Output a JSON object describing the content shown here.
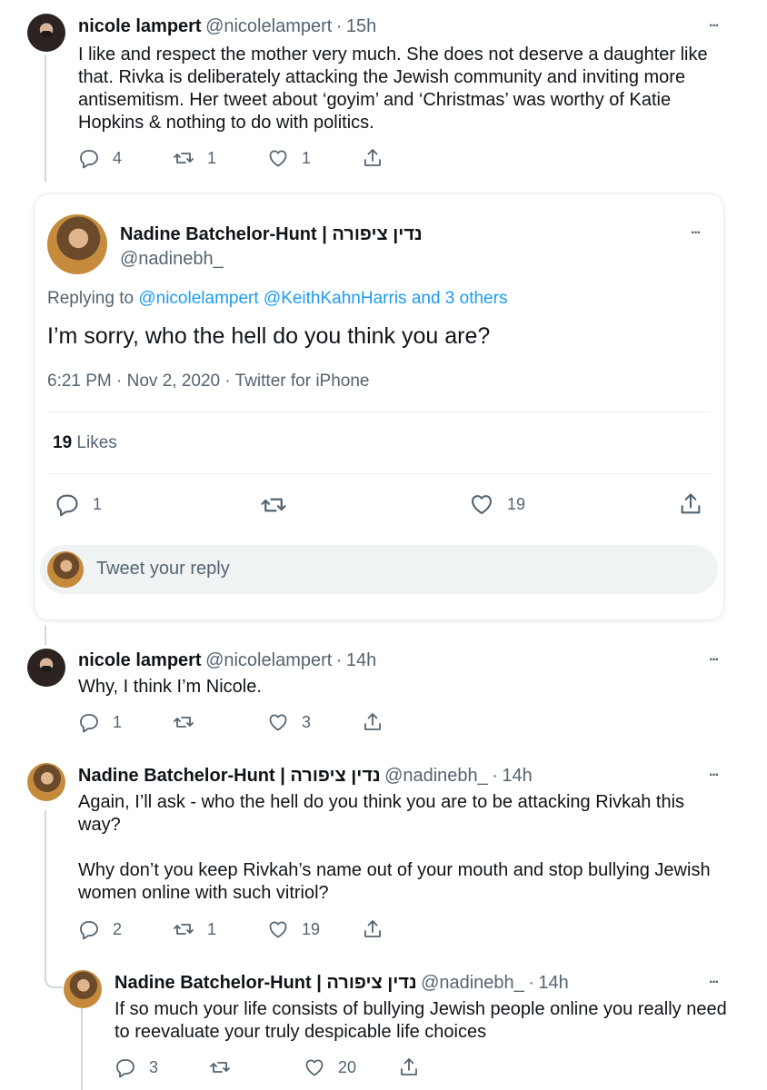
{
  "tweet1": {
    "name": "nicole lampert",
    "handle": "@nicolelampert",
    "time": "15h",
    "text": "I like and respect the mother very much. She does not deserve a daughter like that. Rivka is deliberately attacking the Jewish community and inviting more antisemitism. Her tweet about ‘goyim’ and ‘Christmas’ was worthy of Katie Hopkins & nothing to do with politics.",
    "replies": "4",
    "retweets": "1",
    "likes": "1"
  },
  "focused": {
    "name": "Nadine Batchelor-Hunt | נדין ציפורה",
    "handle": "@nadinebh_",
    "replying_prefix": "Replying to",
    "replying_to": "@nicolelampert @KeithKahnHarris and 3 others",
    "text": "I’m sorry, who the hell do you think you are?",
    "timestamp": "6:21 PM · Nov 2, 2020 · Twitter for iPhone",
    "likes_count": "19",
    "likes_label": "Likes",
    "replies": "1",
    "retweets": "",
    "likes": "19",
    "reply_placeholder": "Tweet your reply"
  },
  "tweet2": {
    "name": "nicole lampert",
    "handle": "@nicolelampert",
    "time": "14h",
    "text": "Why, I think I’m Nicole.",
    "replies": "1",
    "retweets": "",
    "likes": "3"
  },
  "tweet3": {
    "name": "Nadine Batchelor-Hunt | נדין ציפורה",
    "handle": "@nadinebh_",
    "time": "14h",
    "text": "Again, I’ll ask - who the hell do you think you are to be attacking Rivkah this way?\n\nWhy don’t you keep Rivkah’s name out of your mouth and stop bullying Jewish women online with such vitriol?",
    "replies": "2",
    "retweets": "1",
    "likes": "19"
  },
  "tweet4": {
    "name": "Nadine Batchelor-Hunt | נדין ציפורה",
    "handle": "@nadinebh_",
    "time": "14h",
    "text": "If so much your life consists of bullying Jewish people online you really need to reevaluate your truly despicable life choices",
    "replies": "3",
    "retweets": "",
    "likes": "20"
  },
  "separator": "·",
  "more_icon": "···",
  "icons": [
    "reply-icon",
    "retweet-icon",
    "like-icon",
    "share-icon",
    "more-icon"
  ]
}
